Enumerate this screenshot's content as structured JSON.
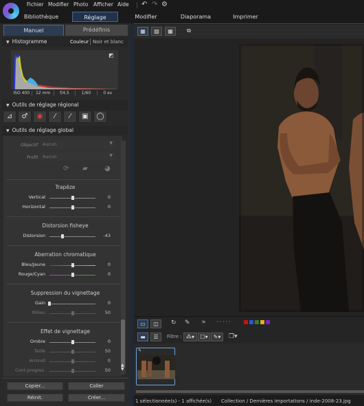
{
  "menu": {
    "items": [
      "Fichier",
      "Modifier",
      "Photo",
      "Afficher",
      "Aide"
    ],
    "undo_icon": "undo-icon",
    "redo_icon": "redo-icon",
    "settings_icon": "gear-icon"
  },
  "modules": {
    "tabs": [
      "Bibliothèque",
      "Réglage",
      "Modifier",
      "Diaporama",
      "Imprimer"
    ],
    "active": "Réglage"
  },
  "left_panel": {
    "subtabs": [
      "Manuel",
      "Prédéfinis"
    ],
    "active_subtab": "Manuel",
    "histogram": {
      "title": "Histogramme",
      "mode_color": "Couleur",
      "mode_bw": "Noir et blanc",
      "info": [
        "ISO 400",
        "12 mm",
        "f/4,5",
        "1/60",
        "0 ev"
      ]
    },
    "regional": {
      "title": "Outils de réglage régional",
      "tools": [
        "crop-icon",
        "spot-removal-icon",
        "red-eye-icon",
        "brush-icon",
        "eraser-brush-icon",
        "gradient-mask-icon",
        "radial-mask-icon"
      ]
    },
    "global": {
      "title": "Outils de réglage global",
      "objectif_label": "Objectif",
      "objectif_value": "Aucun",
      "profil_label": "Profil",
      "profil_value": "Aucun",
      "groups": [
        {
          "title": "Trapèze",
          "sliders": [
            {
              "label": "Vertical",
              "value": "0",
              "pos": 0.5,
              "enabled": true
            },
            {
              "label": "Horizontal",
              "value": "0",
              "pos": 0.5,
              "enabled": true
            }
          ]
        },
        {
          "title": "Distorsion fisheye",
          "sliders": [
            {
              "label": "Distorsion",
              "value": "-43",
              "pos": 0.29,
              "enabled": true
            }
          ]
        },
        {
          "title": "Aberration chromatique",
          "sliders": [
            {
              "label": "Bleu/Jaune",
              "value": "0",
              "pos": 0.5,
              "enabled": true
            },
            {
              "label": "Rouge/Cyan",
              "value": "0",
              "pos": 0.5,
              "enabled": true
            }
          ]
        },
        {
          "title": "Suppression du vignettage",
          "sliders": [
            {
              "label": "Gain",
              "value": "0",
              "pos": 0.0,
              "enabled": true
            },
            {
              "label": "Milieu",
              "value": "50",
              "pos": 0.5,
              "enabled": false
            }
          ]
        },
        {
          "title": "Effet de vignettage",
          "sliders": [
            {
              "label": "Ombre",
              "value": "0",
              "pos": 0.5,
              "enabled": true
            },
            {
              "label": "Taille",
              "value": "50",
              "pos": 0.5,
              "enabled": false
            },
            {
              "label": "Arrondi",
              "value": "0",
              "pos": 0.5,
              "enabled": false
            },
            {
              "label": "Cont.progres.",
              "value": "50",
              "pos": 0.5,
              "enabled": false
            }
          ]
        }
      ]
    },
    "buttons": {
      "copy": "Copier...",
      "paste": "Coller",
      "reset": "Réinit.",
      "create": "Créer..."
    }
  },
  "toolbar": {
    "filter_label": "Filtre :",
    "color_labels": [
      "#cc1111",
      "#2a55dd",
      "#3a7a2a",
      "#e0b020",
      "#7a22c8"
    ]
  },
  "status": {
    "selection": "1 sélectionnée(s) - 1 affichée(s)",
    "path": "Collection / Dernières importations / inde-2008-23.jpg"
  }
}
